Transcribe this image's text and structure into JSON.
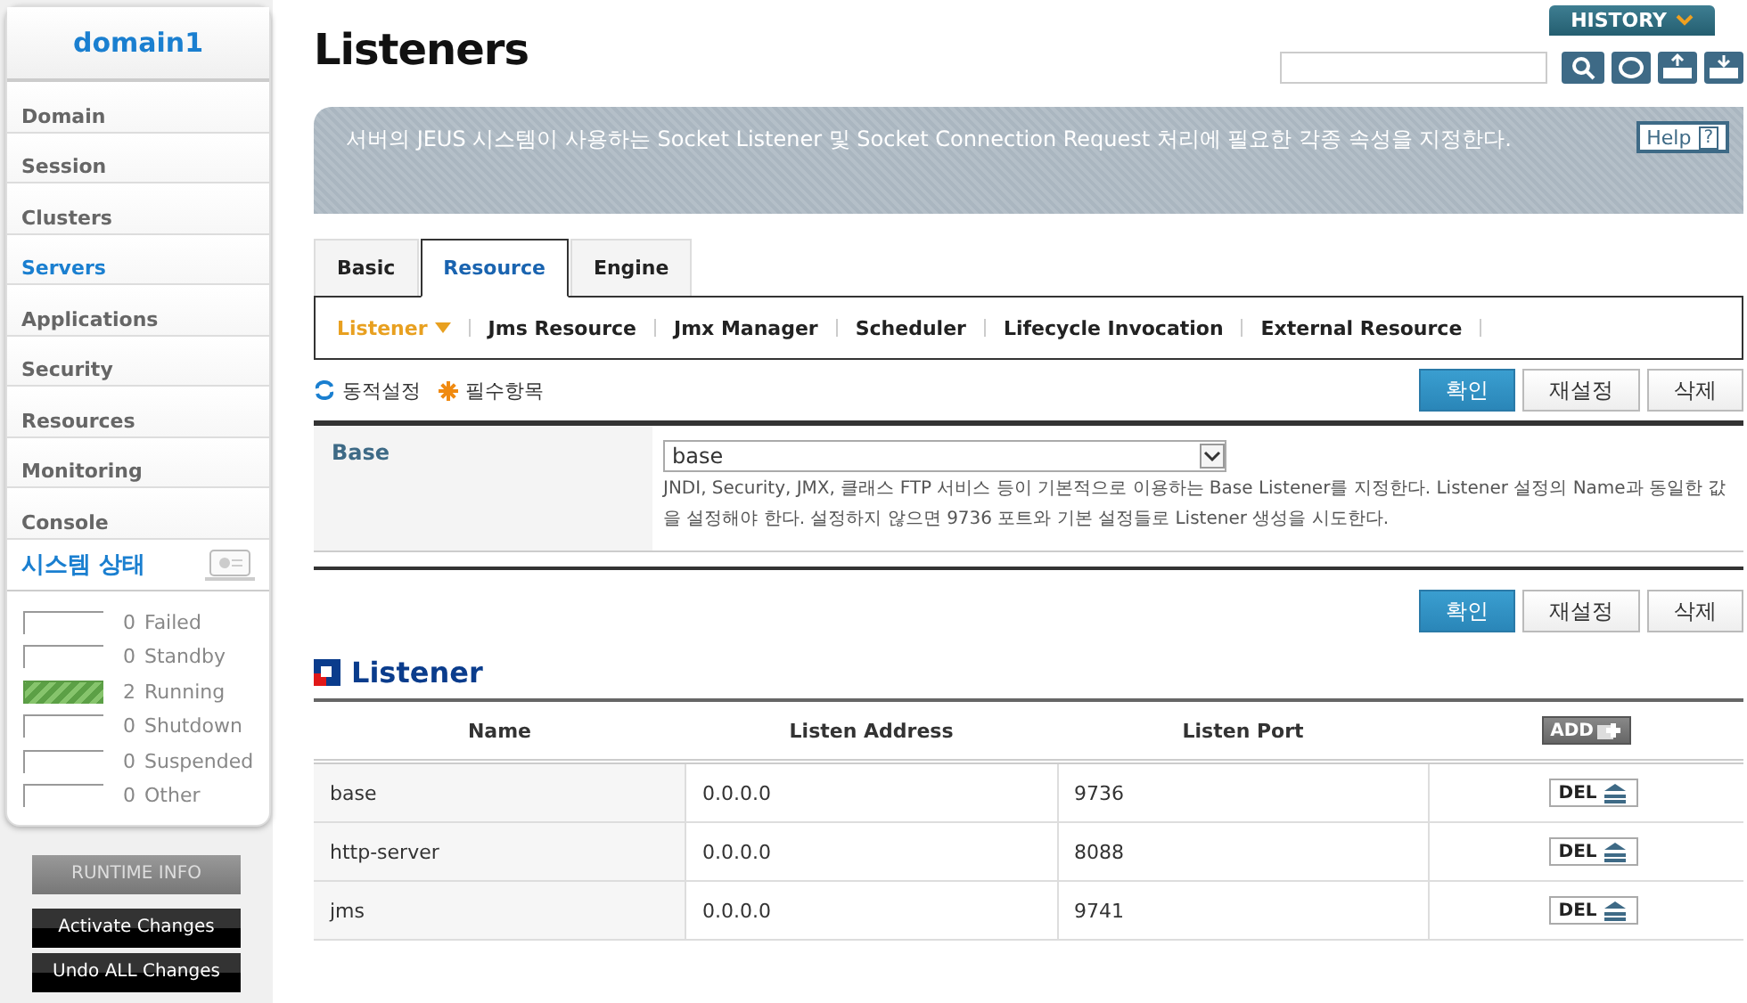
{
  "sidebar": {
    "domain": "domain1",
    "items": [
      {
        "label": "Domain",
        "selected": false
      },
      {
        "label": "Session",
        "selected": false
      },
      {
        "label": "Clusters",
        "selected": false
      },
      {
        "label": "Servers",
        "selected": true
      },
      {
        "label": "Applications",
        "selected": false
      },
      {
        "label": "Security",
        "selected": false
      },
      {
        "label": "Resources",
        "selected": false
      },
      {
        "label": "Monitoring",
        "selected": false
      },
      {
        "label": "Console",
        "selected": false
      }
    ],
    "status_title": "시스템 상태",
    "status": [
      {
        "count": "0",
        "label": "Failed",
        "active": false
      },
      {
        "count": "0",
        "label": "Standby",
        "active": false
      },
      {
        "count": "2",
        "label": "Running",
        "active": true
      },
      {
        "count": "0",
        "label": "Shutdown",
        "active": false
      },
      {
        "count": "0",
        "label": "Suspended",
        "active": false
      },
      {
        "count": "0",
        "label": "Other",
        "active": false
      }
    ],
    "runtime_button": "RUNTIME INFO",
    "actions": [
      "Activate Changes",
      "Undo ALL Changes"
    ]
  },
  "page": {
    "title": "Listeners",
    "history": "HISTORY",
    "description": "서버의 JEUS 시스템이 사용하는 Socket Listener 및 Socket Connection Request 처리에 필요한 각종 속성을 지정한다.",
    "help": "Help",
    "help_mark": "?"
  },
  "tabs": [
    {
      "label": "Basic",
      "selected": false
    },
    {
      "label": "Resource",
      "selected": true
    },
    {
      "label": "Engine",
      "selected": false
    }
  ],
  "subtabs": [
    {
      "label": "Listener",
      "selected": true
    },
    {
      "label": "Jms Resource",
      "selected": false
    },
    {
      "label": "Jmx Manager",
      "selected": false
    },
    {
      "label": "Scheduler",
      "selected": false
    },
    {
      "label": "Lifecycle Invocation",
      "selected": false
    },
    {
      "label": "External Resource",
      "selected": false
    }
  ],
  "legend": {
    "dynamic": "동적설정",
    "required": "필수항목"
  },
  "buttons": [
    "확인",
    "재설정",
    "삭제"
  ],
  "base": {
    "label": "Base",
    "value": "base",
    "help": "JNDI, Security, JMX, 클래스 FTP 서비스 등이 기본적으로 이용하는 Base Listener를 지정한다. Listener 설정의 Name과 동일한 값을 설정해야 한다. 설정하지 않으면 9736 포트와 기본 설정들로 Listener 생성을 시도한다."
  },
  "buttons_2": [
    "확인",
    "재설정",
    "삭제"
  ],
  "listener": {
    "title": "Listener",
    "columns": [
      "Name",
      "Listen Address",
      "Listen Port"
    ],
    "add": "ADD",
    "rows": [
      {
        "name": "base",
        "address": "0.0.0.0",
        "port": "9736",
        "del": "DEL"
      },
      {
        "name": "http-server",
        "address": "0.0.0.0",
        "port": "8088",
        "del": "DEL"
      },
      {
        "name": "jms",
        "address": "0.0.0.0",
        "port": "9741",
        "del": "DEL"
      }
    ]
  }
}
